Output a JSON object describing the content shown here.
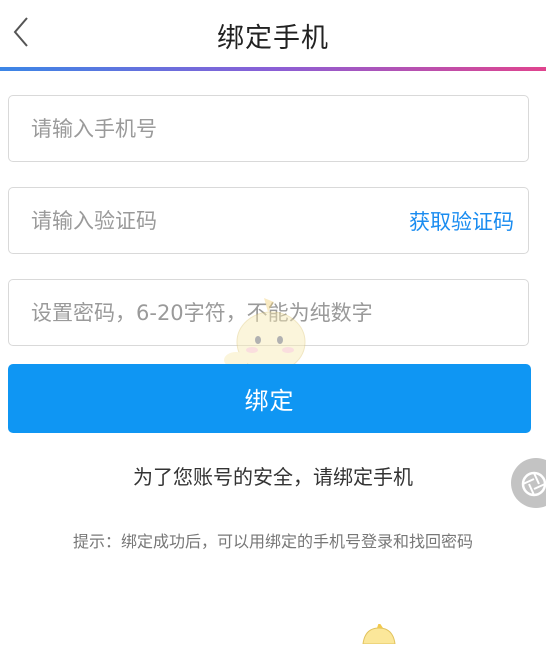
{
  "header": {
    "title": "绑定手机",
    "back_icon": "chevron-left-icon"
  },
  "form": {
    "phone": {
      "placeholder": "请输入手机号",
      "value": ""
    },
    "code": {
      "placeholder": "请输入验证码",
      "value": "",
      "get_code_label": "获取验证码"
    },
    "password": {
      "placeholder": "设置密码，6-20字符，不能为纯数字",
      "value": ""
    },
    "submit_label": "绑定"
  },
  "notice": "为了您账号的安全，请绑定手机",
  "tip": "提示：绑定成功后，可以用绑定的手机号登录和找回密码",
  "float_button": {
    "icon": "shutter-icon"
  },
  "colors": {
    "accent": "#0f96f3",
    "link": "#1a8cf0",
    "gradient_start": "#3b86e6",
    "gradient_end": "#e0448e"
  }
}
